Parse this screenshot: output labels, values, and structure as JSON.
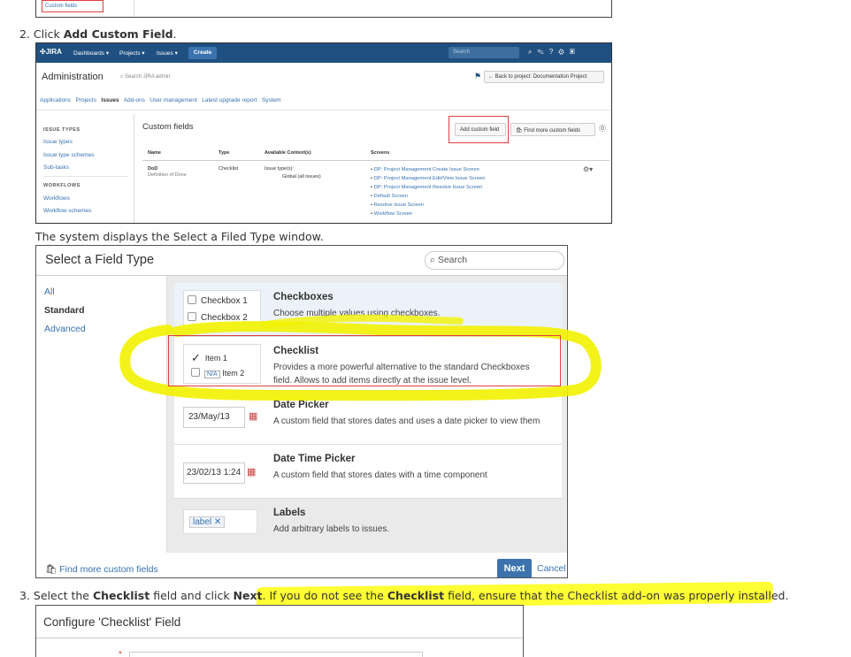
{
  "top_shot": {
    "custom_fields_label": "Custom fields"
  },
  "step2": {
    "num": "2.",
    "pre": "Click ",
    "bold": "Add Custom Field",
    "post": "."
  },
  "jira": {
    "logo": "JIRA",
    "nav": [
      "Dashboards ▾",
      "Projects ▾",
      "Issues ▾"
    ],
    "create": "Create",
    "search_placeholder": "Search",
    "admin_title": "Administration",
    "admin_search": "Search JIRA admin",
    "back_button": "← Back to project: Documentation Project",
    "tabs": [
      "Applications",
      "Projects",
      "Issues",
      "Add-ons",
      "User management",
      "Latest upgrade report",
      "System"
    ],
    "current_tab": "Issues",
    "sidebar": {
      "issue_types_heading": "ISSUE TYPES",
      "issue_types_items": [
        "Issue types",
        "Issue type schemes",
        "Sub-tasks"
      ],
      "workflows_heading": "WORKFLOWS",
      "workflows_items": [
        "Workflows",
        "Workflow schemes"
      ]
    },
    "page_title": "Custom fields",
    "add_button": "Add custom field",
    "find_button": "Find more custom fields",
    "table": {
      "headers": [
        "Name",
        "Type",
        "Available Context(s)",
        "Screens"
      ],
      "row": {
        "name": "DoD",
        "desc": "Definition of Done",
        "type": "Checklist",
        "context1": "Issue type(s):",
        "context2": "Global (all issues)",
        "screens": [
          "DP: Project Management Create Issue Screen",
          "DP: Project Management Edit/View Issue Screen",
          "DP: Project Management Resolve Issue Screen",
          "Default Screen",
          "Resolve Issue Screen",
          "Workflow Screen"
        ]
      }
    }
  },
  "caption": "The system displays the Select a Filed Type window.",
  "dialog": {
    "title": "Select a Field Type",
    "search_placeholder": "Search",
    "side": [
      "All",
      "Standard",
      "Advanced"
    ],
    "types": [
      {
        "name": "Checkboxes",
        "desc": "Choose multiple values using checkboxes.",
        "preview": [
          "Checkbox 1",
          "Checkbox 2"
        ]
      },
      {
        "name": "Checklist",
        "desc": "Provides a more powerful alternative to the standard Checkboxes field. Allows to add items directly at the issue level.",
        "preview": [
          "Item 1",
          "N/A",
          "Item 2"
        ]
      },
      {
        "name": "Date Picker",
        "desc": "A custom field that stores dates and uses a date picker to view them",
        "preview": "23/May/13"
      },
      {
        "name": "Date Time Picker",
        "desc": "A custom field that stores dates with a time component",
        "preview": "23/02/13 1:24"
      },
      {
        "name": "Labels",
        "desc": "Add arbitrary labels to issues.",
        "preview": "label"
      }
    ],
    "find_more": "Find more custom fields",
    "next": "Next",
    "cancel": "Cancel"
  },
  "step3": {
    "num": "3.",
    "pre": "Select the ",
    "bold1": "Checklist",
    "mid": " field and click ",
    "bold2": "Next",
    "dot": ".",
    "hl_pre": " If you do not see the ",
    "hl_bold": "Checklist",
    "hl_post": " field, ensure that the Checklist add-on was properly installed."
  },
  "config": {
    "title": "Configure 'Checklist' Field"
  },
  "colors": {
    "jira_nav": "#205081",
    "link": "#3572b0",
    "highlight": "#ffff00",
    "red_box": "#e04040"
  }
}
